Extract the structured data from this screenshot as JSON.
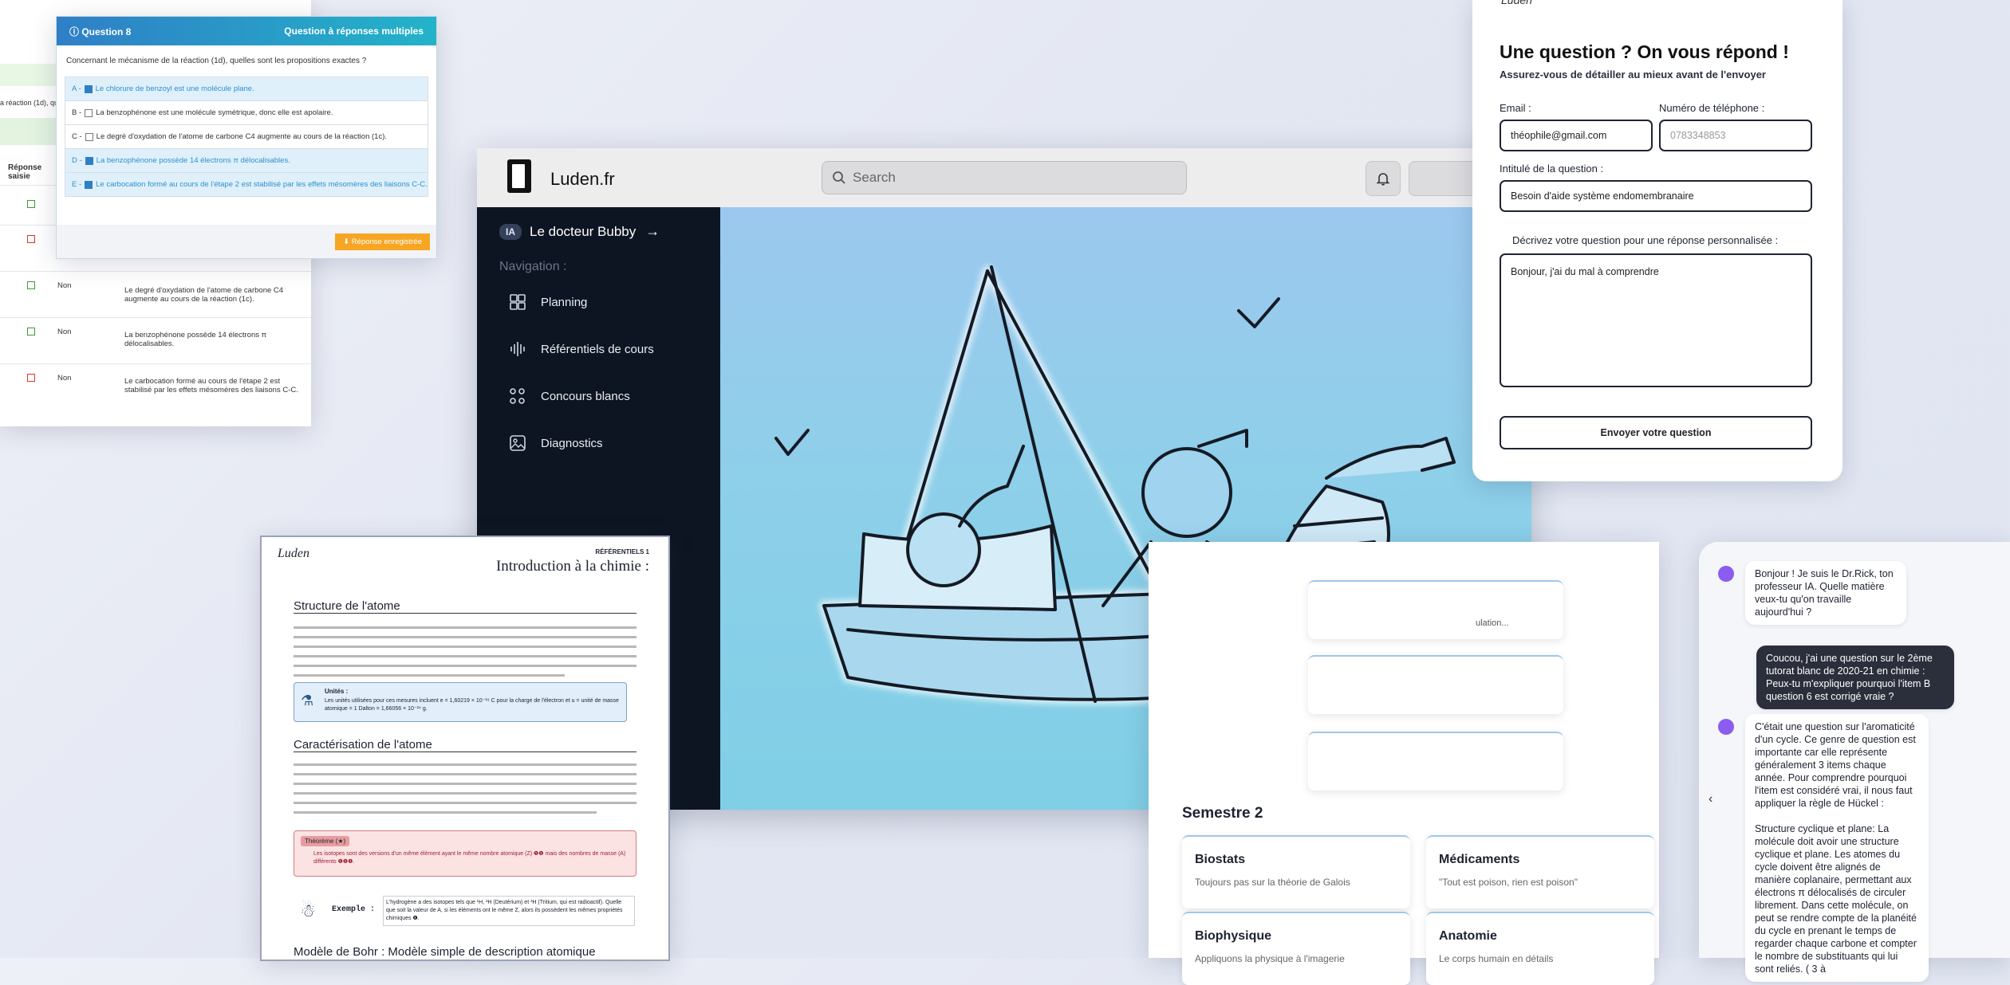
{
  "quiz": {
    "question_label": "Question 8",
    "question_type": "Question à réponses multiples",
    "question_text": "Concernant le mécanisme de la réaction (1d), quelles sont les propositions exactes ?",
    "options": [
      {
        "letter": "A -",
        "text": "Le chlorure de benzoyl est une molécule plane.",
        "checked": true
      },
      {
        "letter": "B -",
        "text": "La benzophénone est une molécule symétrique, donc elle est apolaire.",
        "checked": false
      },
      {
        "letter": "C -",
        "text": "Le degré d'oxydation de l'atome de carbone C4 augmente au cours de la réaction (1c).",
        "checked": false
      },
      {
        "letter": "D -",
        "text": "La benzophénone possède 14 électrons π délocalisables.",
        "checked": true
      },
      {
        "letter": "E -",
        "text": "Le carbocation formé au cours de l'étape 2 est stabilisé par les effets mésomères des liaisons C-C.",
        "checked": true
      }
    ],
    "save_button": "Réponse enregistrée",
    "bg_fragment": "a réaction (1d), quel",
    "table_header": "Réponse saisie",
    "rows": [
      {
        "answer": "Non",
        "text": "Le degré d'oxydation de l'atome de carbone C4 augmente au cours de la réaction (1c)."
      },
      {
        "answer": "Non",
        "text": "La benzophénone possède 14 électrons π délocalisables."
      },
      {
        "answer": "Non",
        "text": "Le carbocation formé au cours de l'étape 2 est stabilisé par les effets mésomères des liaisons C-C."
      }
    ]
  },
  "app": {
    "brand": "Luden.fr",
    "search_placeholder": "Search",
    "ia_badge": "IA",
    "assistant_link": "Le docteur Bubby",
    "nav_title": "Navigation :",
    "nav_items": [
      {
        "label": "Planning",
        "icon": "calendar-icon"
      },
      {
        "label": "Référentiels de cours",
        "icon": "waveform-icon"
      },
      {
        "label": "Concours blancs",
        "icon": "nodes-icon"
      },
      {
        "label": "Diagnostics",
        "icon": "image-icon"
      }
    ]
  },
  "form": {
    "logo_text": "Luden",
    "title": "Une question ? On vous répond !",
    "subtitle": "Assurez-vous de détailler au mieux avant de l'envoyer",
    "email_label": "Email :",
    "email_value": "théophile@gmail.com",
    "phone_label": "Numéro de téléphone :",
    "phone_value": "0783348853",
    "subject_label": "Intitulé de la question :",
    "subject_value": "Besoin d'aide système endomembranaire",
    "desc_label": "Décrivez votre question pour une réponse personnalisée :",
    "desc_value": "Bonjour, j'ai du mal à comprendre",
    "submit_button": "Envoyer votre question"
  },
  "document": {
    "logo_text": "Luden",
    "tag": "RÉFÉRENTIELS 1",
    "title": "Introduction à la chimie :",
    "section1": "Structure de l'atome",
    "units_title": "Unités :",
    "units_text": "Les unités utilisées pour ces mesures incluent e = 1,60219 × 10⁻¹⁹ C pour la charge de l'électron et u = unité de masse atomique = 1 Dalton = 1,66056 × 10⁻²⁴ g.",
    "section2": "Caractérisation de l'atome",
    "theorem_title": "Théorème (★)",
    "theorem_text": "Les isotopes sont des versions d'un même élément ayant le même nombre atomique (Z) ❶❶ mais des nombres de masse (A) différents ❶❶❶.",
    "example_label": "Exemple :",
    "example_text": "L'hydrogène a des isotopes tels que ¹H, ²H (Deutérium) et ³H (Tritium, qui est radioactif). Quelle que soit la valeur de A, si les éléments ont le même Z, alors ils possèdent les mêmes propriétés chimiques ❶.",
    "section3": "Modèle de Bohr : Modèle simple de description atomique"
  },
  "semestre": {
    "fragment": "ulation...",
    "title": "Semestre 2",
    "cards": [
      {
        "name": "Biostats",
        "desc": "Toujours pas sur la théorie de Galois"
      },
      {
        "name": "Médicaments",
        "desc": "\"Tout est poison, rien est poison\""
      },
      {
        "name": "Biophysique",
        "desc": "Appliquons la physique à l'imagerie"
      },
      {
        "name": "Anatomie",
        "desc": "Le corps humain en détails"
      }
    ]
  },
  "chat": {
    "bot_greeting": "Bonjour ! Je suis le Dr.Rick, ton professeur IA. Quelle matière veux-tu qu'on travaille aujourd'hui ?",
    "user_message": "Coucou, j'ai une question sur le 2ème tutorat blanc de 2020-21 en chimie : Peux-tu m'expliquer pourquoi l'item B question 6 est corrigé vraie ?",
    "bot_reply_1": "C'était une question sur l'aromaticité d'un cycle. Ce genre de question est importante car elle représente généralement 3 items chaque année. Pour comprendre pourquoi l'item est considéré vrai, il nous faut appliquer la règle de Hückel :",
    "bot_reply_2": "Structure cyclique et plane: La molécule doit avoir une structure cyclique et plane. Les atomes du cycle doivent être alignés de manière coplanaire, permettant aux électrons π délocalisés de circuler librement. Dans cette molécule, on peut se rendre compte de la planéité du cycle en prenant le temps de regarder chaque carbone et compter le nombre de substituants qui lui sont reliés. ( 3 à"
  },
  "colors": {
    "accent_blue": "#2f7fc6",
    "sidebar": "#0e1522",
    "orange": "#f6a623",
    "chat_user": "#2b2f3c",
    "bot_purple": "#8a5cf0"
  }
}
